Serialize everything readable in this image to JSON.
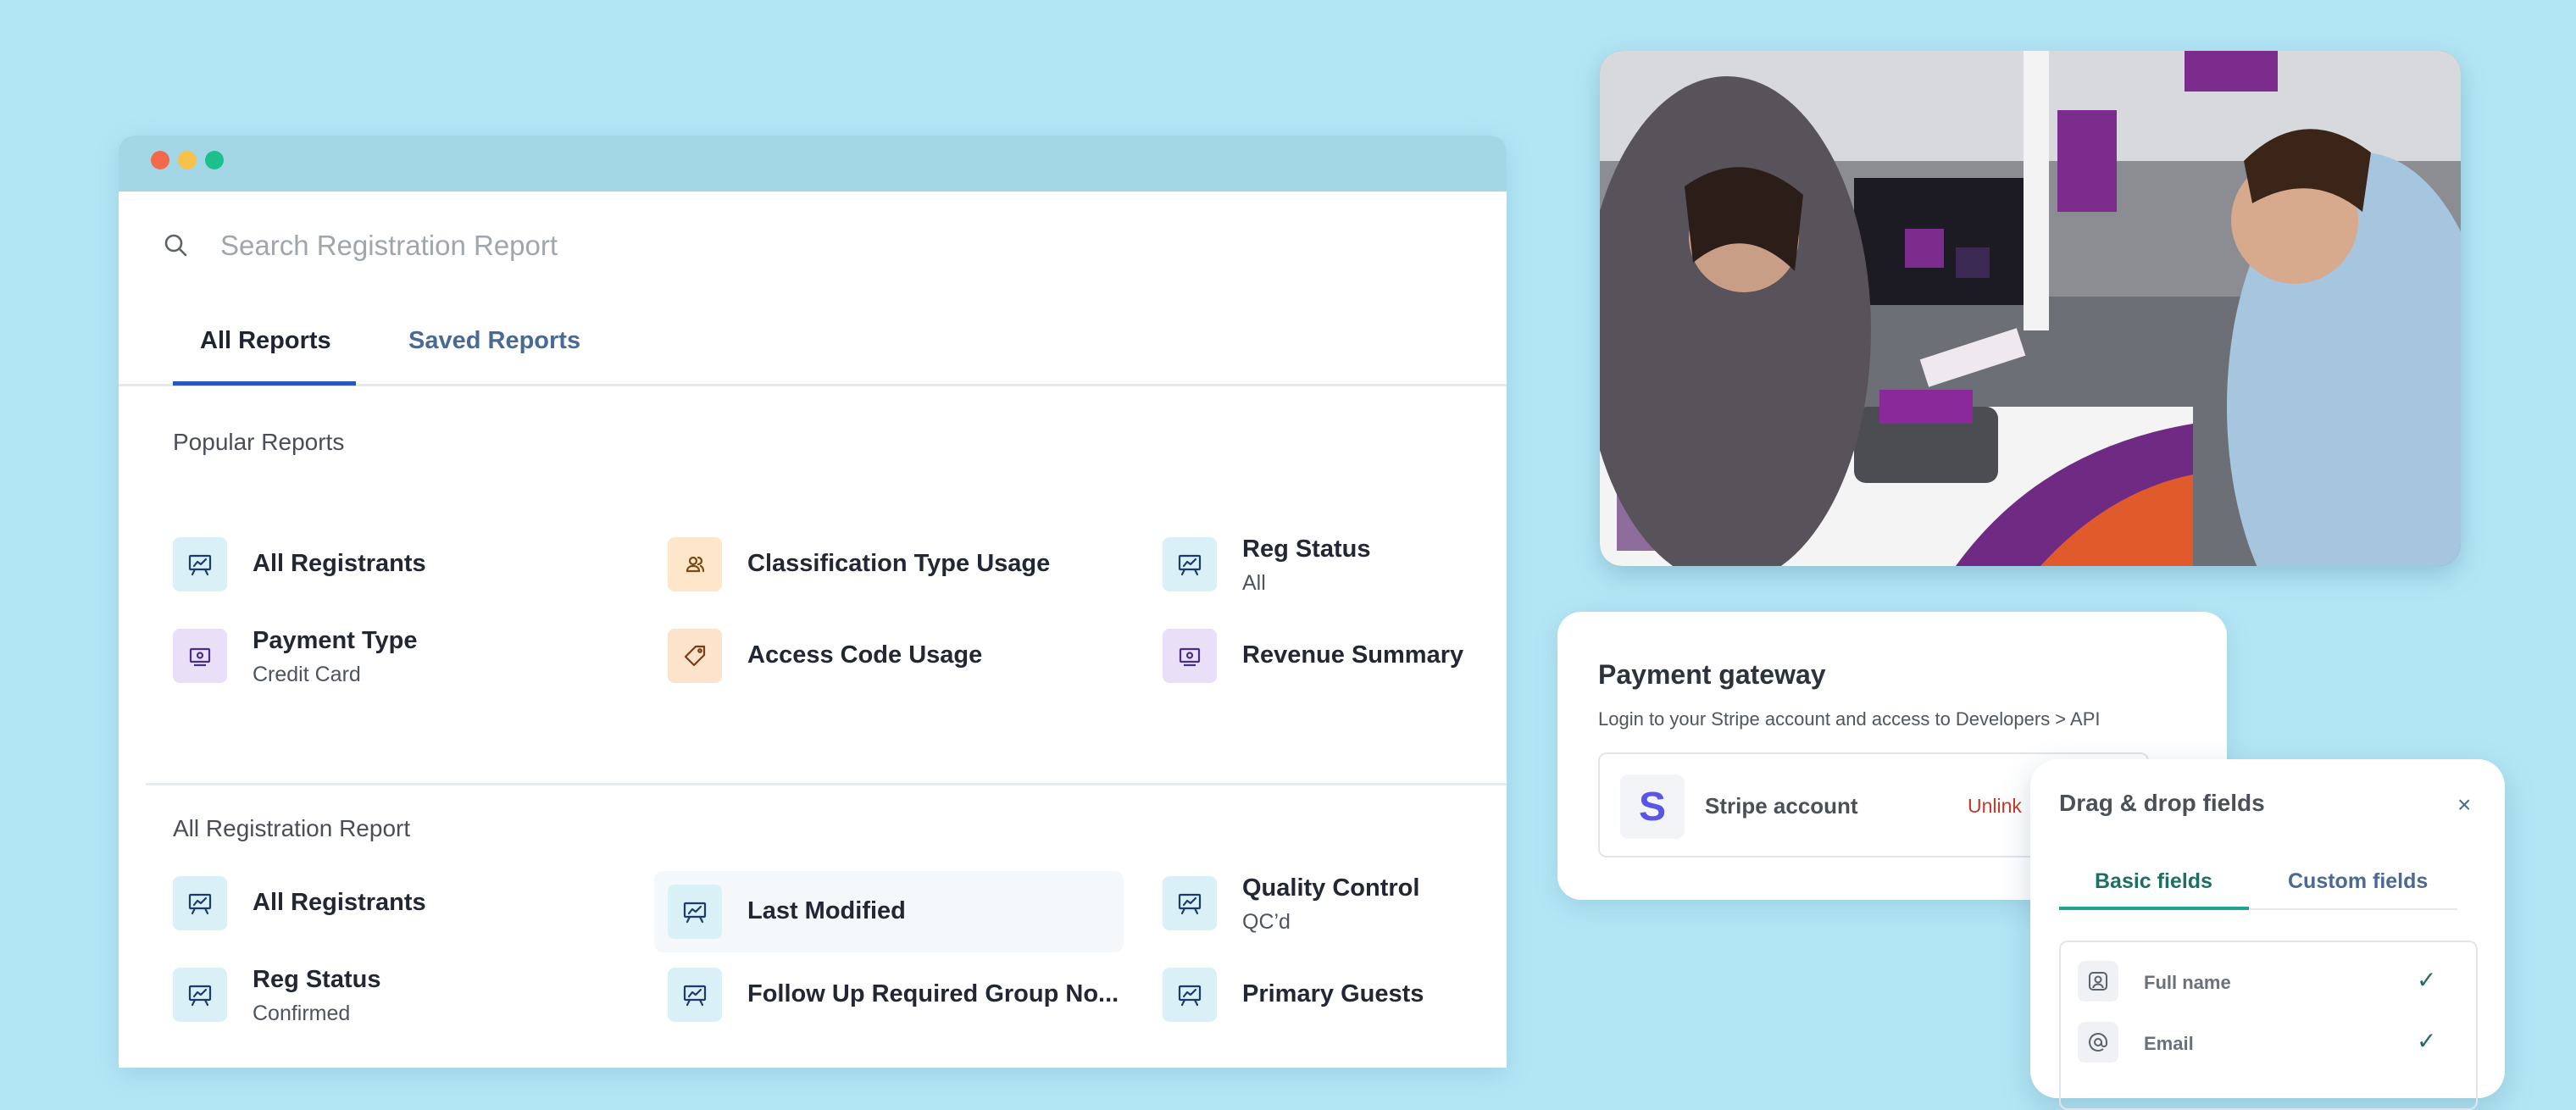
{
  "window": {
    "search": {
      "placeholder": "Search Registration Report"
    },
    "tabs": [
      {
        "label": "All Reports",
        "active": true
      },
      {
        "label": "Saved Reports",
        "active": false
      }
    ],
    "popular": {
      "title": "Popular Reports",
      "items": [
        {
          "label": "All Registrants",
          "sub": "",
          "icon": "presentation-chart-icon"
        },
        {
          "label": "Classification Type Usage",
          "sub": "",
          "icon": "users-icon"
        },
        {
          "label": "Reg Status",
          "sub": "All",
          "icon": "presentation-chart-icon"
        },
        {
          "label": "Payment Type",
          "sub": "Credit Card",
          "icon": "money-bill-icon"
        },
        {
          "label": "Access Code Usage",
          "sub": "",
          "icon": "tag-icon"
        },
        {
          "label": "Revenue Summary",
          "sub": "",
          "icon": "money-bill-icon"
        }
      ]
    },
    "all": {
      "title": "All Registration Report",
      "items": [
        {
          "label": "All Registrants",
          "sub": "",
          "icon": "presentation-chart-icon"
        },
        {
          "label": "Last Modified",
          "sub": "",
          "icon": "presentation-chart-icon"
        },
        {
          "label": "Quality Control",
          "sub": "QC’d",
          "icon": "presentation-chart-icon"
        },
        {
          "label": "Reg Status",
          "sub": "Confirmed",
          "icon": "presentation-chart-icon"
        },
        {
          "label": "Follow Up Required Group No...",
          "sub": "",
          "icon": "presentation-chart-icon"
        },
        {
          "label": "Primary Guests",
          "sub": "",
          "icon": "presentation-chart-icon"
        }
      ]
    }
  },
  "payment": {
    "title": "Payment gateway",
    "description": "Login to your Stripe account and access to Developers > API",
    "stripe_logo": "S",
    "account_label": "Stripe account",
    "unlink_label": "Unlink"
  },
  "dragdrop": {
    "title": "Drag & drop fields",
    "close": "×",
    "tabs": [
      {
        "label": "Basic fields",
        "active": true
      },
      {
        "label": "Custom fields",
        "active": false
      }
    ],
    "fields": [
      {
        "label": "Full name",
        "icon": "user-circle-icon",
        "checked": true
      },
      {
        "label": "Email",
        "icon": "at-sign-icon",
        "checked": true
      }
    ],
    "check_mark": "✓"
  },
  "colors": {
    "background": "#b3e6f5",
    "tab_accent": "#2856c9",
    "unlink": "#c0392b",
    "stripe": "#5a55e8",
    "dd_accent": "#1aa590"
  }
}
